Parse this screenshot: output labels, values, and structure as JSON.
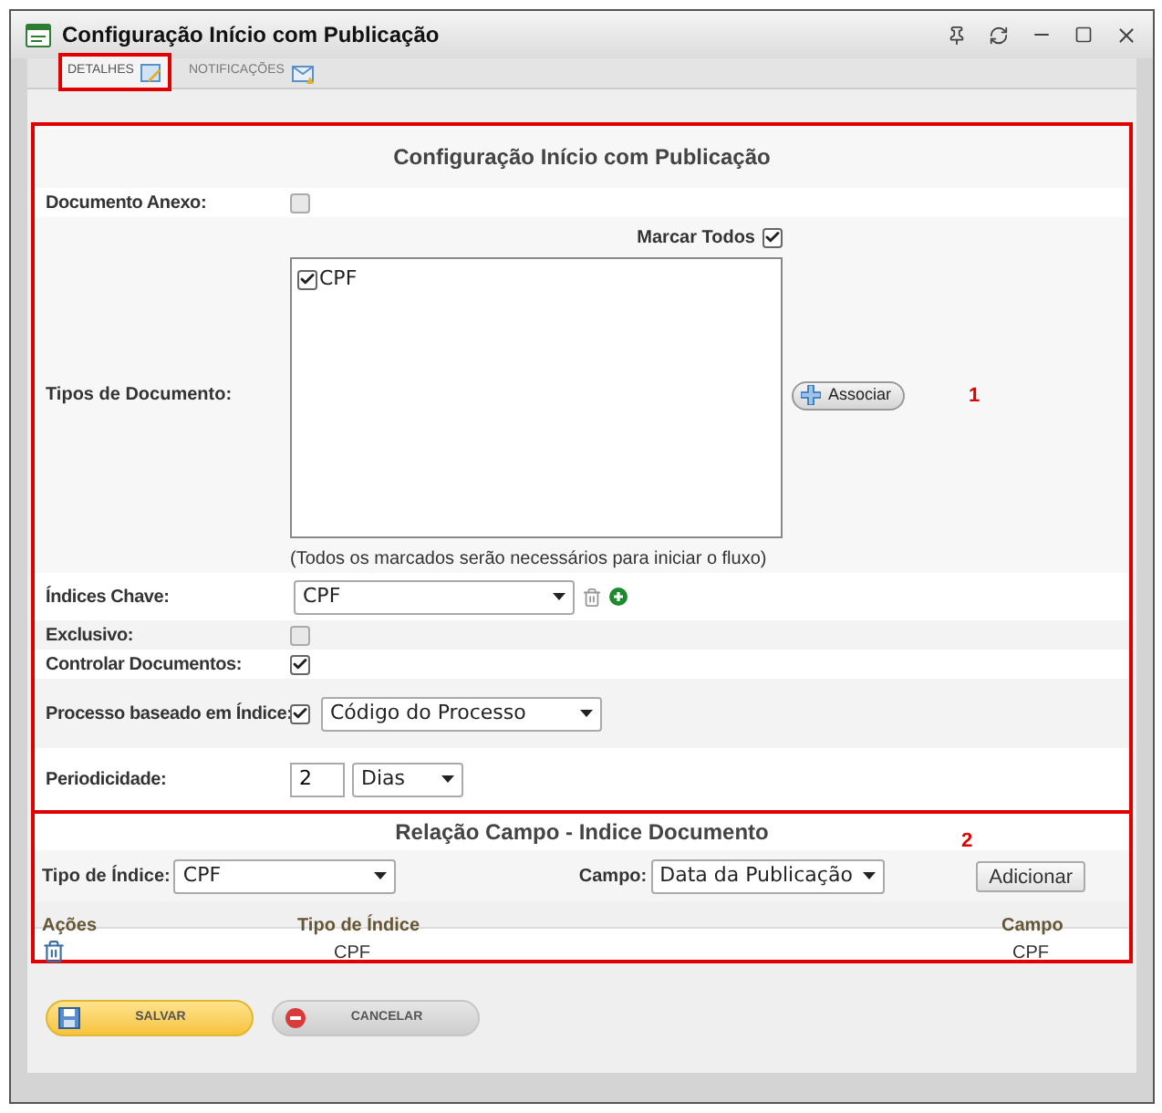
{
  "window": {
    "title": "Configuração Início com Publicação"
  },
  "tabs": [
    {
      "label": "DETALHES",
      "selected": true,
      "highlighted": true
    },
    {
      "label": "NOTIFICAÇÕES",
      "selected": false,
      "highlighted": false
    }
  ],
  "section1": {
    "number": "1",
    "title": "Configuração Início com Publicação",
    "documento_anexo": {
      "label": "Documento Anexo:",
      "checked": false
    },
    "tipos_documento": {
      "label": "Tipos de Documento:",
      "select_all": {
        "label": "Marcar Todos",
        "checked": true
      },
      "items": [
        {
          "label": "CPF",
          "checked": true
        }
      ],
      "note": "(Todos os marcados serão necessários para iniciar o fluxo)",
      "button": "Associar"
    },
    "indices_chave": {
      "label": "Índices Chave:",
      "value": "CPF"
    },
    "exclusivo": {
      "label": "Exclusivo:",
      "checked": false
    },
    "controlar_documentos": {
      "label": "Controlar Documentos:",
      "checked": true
    },
    "processo_indice": {
      "label": "Processo baseado em Índice:",
      "checked": true,
      "value": "Código do Processo"
    },
    "periodicidade": {
      "label": "Periodicidade:",
      "value": "2",
      "unit": "Dias"
    }
  },
  "section2": {
    "number": "2",
    "title": "Relação Campo - Indice Documento",
    "tipo_indice": {
      "label": "Tipo de Índice:",
      "value": "CPF"
    },
    "campo": {
      "label": "Campo:",
      "value": "Data da Publicação"
    },
    "add_button": "Adicionar",
    "table": {
      "columns": [
        "Ações",
        "Tipo de Índice",
        "Campo"
      ],
      "rows": [
        {
          "tipo": "CPF",
          "campo": "CPF"
        }
      ]
    }
  },
  "buttons": [
    {
      "label": "SALVAR",
      "kind": "primary"
    },
    {
      "label": "CANCELAR",
      "kind": "secondary"
    }
  ]
}
